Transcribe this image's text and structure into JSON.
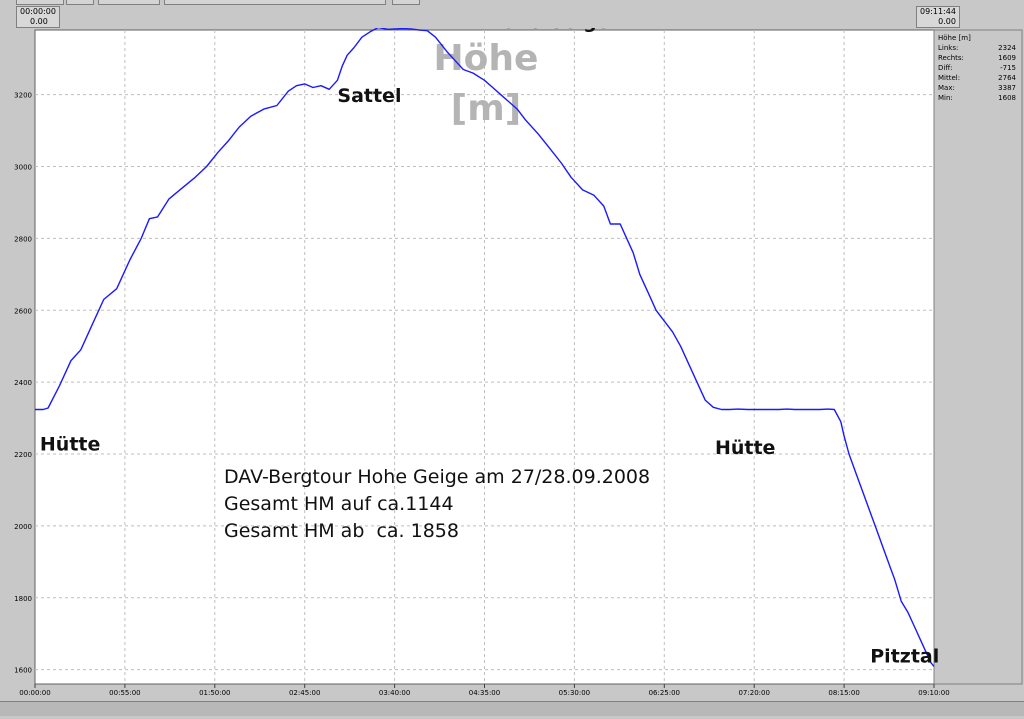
{
  "header": {
    "left_time": "00:00:00",
    "left_value": "0.00",
    "right_time": "09:11:44",
    "right_value": "0.00"
  },
  "stats_panel": {
    "title": "Höhe [m]",
    "rows": [
      {
        "label": "Links:",
        "value": "2324"
      },
      {
        "label": "Rechts:",
        "value": "1609"
      },
      {
        "label": "Diff:",
        "value": "-715"
      },
      {
        "label": "Mittel:",
        "value": "2764"
      },
      {
        "label": "Max:",
        "value": "3387"
      },
      {
        "label": "Min:",
        "value": "1608"
      }
    ]
  },
  "colors": {
    "line": "#1a1aff",
    "grid": "#bfbfbf",
    "plot_bg": "#ffffff",
    "frame_bg": "#c8c8c8",
    "watermark": "#b4b4b4"
  },
  "chart_data": {
    "type": "line",
    "title": "",
    "watermark_label": [
      "Höhe",
      "[m]"
    ],
    "xlabel": "",
    "ylabel": "",
    "xlim_minutes": [
      0,
      550
    ],
    "ylim": [
      1560,
      3380
    ],
    "grid": true,
    "legend": "none",
    "x_ticks": [
      {
        "label": "00:00:00",
        "minutes": 0
      },
      {
        "label": "00:55:00",
        "minutes": 55
      },
      {
        "label": "01:50:00",
        "minutes": 110
      },
      {
        "label": "02:45:00",
        "minutes": 165
      },
      {
        "label": "03:40:00",
        "minutes": 220
      },
      {
        "label": "04:35:00",
        "minutes": 275
      },
      {
        "label": "05:30:00",
        "minutes": 330
      },
      {
        "label": "06:25:00",
        "minutes": 385
      },
      {
        "label": "07:20:00",
        "minutes": 440
      },
      {
        "label": "08:15:00",
        "minutes": 495
      },
      {
        "label": "09:10:00",
        "minutes": 550
      }
    ],
    "y_ticks": [
      1600,
      1800,
      2000,
      2200,
      2400,
      2600,
      2800,
      3000,
      3200
    ],
    "series": [
      {
        "x_minutes": [
          0,
          5,
          8,
          15,
          22,
          28,
          35,
          42,
          50,
          58,
          65,
          70,
          75,
          82,
          90,
          98,
          105,
          112,
          118,
          125,
          132,
          140,
          148,
          155,
          160,
          165,
          170,
          175,
          180,
          185,
          188,
          191,
          195,
          200,
          205,
          210,
          212,
          216,
          220,
          225,
          230,
          235,
          240,
          245,
          252,
          258,
          262,
          268,
          275,
          280,
          285,
          290,
          295,
          300,
          308,
          315,
          322,
          328,
          335,
          342,
          348,
          352,
          358,
          362,
          366,
          370,
          375,
          380,
          385,
          390,
          395,
          400,
          405,
          410,
          415,
          420,
          425,
          430,
          436,
          440,
          445,
          450,
          455,
          460,
          465,
          470,
          475,
          480,
          485,
          489,
          493,
          495,
          498,
          502,
          506,
          510,
          514,
          518,
          522,
          526,
          530,
          534,
          538,
          541,
          544,
          546,
          548,
          550
        ],
        "y": [
          2324,
          2324,
          2328,
          2390,
          2460,
          2490,
          2560,
          2630,
          2660,
          2740,
          2800,
          2855,
          2860,
          2910,
          2940,
          2970,
          3000,
          3040,
          3070,
          3110,
          3140,
          3160,
          3170,
          3210,
          3225,
          3230,
          3220,
          3225,
          3215,
          3240,
          3280,
          3310,
          3330,
          3360,
          3375,
          3387,
          3385,
          3382,
          3383,
          3384,
          3383,
          3380,
          3378,
          3360,
          3320,
          3290,
          3270,
          3260,
          3240,
          3220,
          3200,
          3180,
          3160,
          3130,
          3090,
          3050,
          3010,
          2970,
          2935,
          2920,
          2890,
          2840,
          2840,
          2800,
          2760,
          2700,
          2650,
          2600,
          2570,
          2540,
          2500,
          2450,
          2400,
          2350,
          2330,
          2324,
          2324,
          2325,
          2324,
          2324,
          2324,
          2324,
          2324,
          2325,
          2324,
          2324,
          2324,
          2324,
          2325,
          2324,
          2290,
          2250,
          2200,
          2150,
          2100,
          2050,
          2000,
          1950,
          1900,
          1850,
          1790,
          1760,
          1720,
          1690,
          1660,
          1640,
          1620,
          1609
        ]
      }
    ],
    "annotations": [
      {
        "text": "Hütte",
        "x_minutes": 3,
        "y": 2210
      },
      {
        "text": "Sattel",
        "x_minutes": 185,
        "y": 3180
      },
      {
        "text": "Hohe Geige",
        "x_minutes": 276,
        "y": 3385
      },
      {
        "text": "Hütte",
        "x_minutes": 416,
        "y": 2200
      },
      {
        "text": "Pitztal",
        "x_minutes": 511,
        "y": 1620
      }
    ],
    "info_lines": [
      "DAV-Bergtour Hohe Geige am 27/28.09.2008",
      "Gesamt HM auf ca.1144",
      "Gesamt HM ab  ca. 1858"
    ]
  }
}
